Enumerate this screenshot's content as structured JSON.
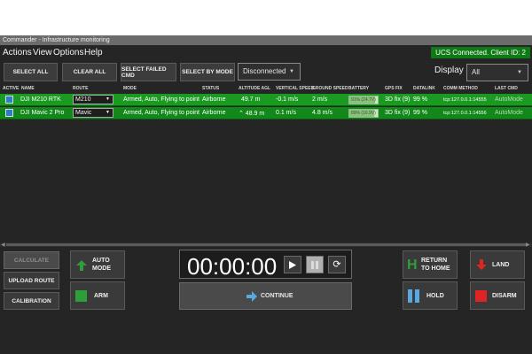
{
  "window": {
    "title": "Commander - Infrastructure monitoring"
  },
  "menu": {
    "items": [
      "Actions",
      "View",
      "Options",
      "Help"
    ]
  },
  "connection": {
    "status_text": "UCS Connected. Client ID: 2",
    "color": "#0d7a15"
  },
  "toolbar": {
    "select_all": "SELECT ALL",
    "clear_all": "CLEAR ALL",
    "select_failed_cmd": "SELECT FAILED CMD",
    "select_by_mode": "SELECT BY MODE",
    "connection_select_value": "Disconnected",
    "display_label": "Display",
    "display_select_value": "All"
  },
  "table": {
    "headers": [
      "ACTIVE",
      "NAME",
      "ROUTE",
      "MODE",
      "STATUS",
      "ALTITUDE AGL",
      "VERTICAL SPEED",
      "GROUND SPEED",
      "BATTERY",
      "GPS FIX",
      "DATALINK",
      "COMM METHOD",
      "LAST CMD"
    ],
    "rows": [
      {
        "active": true,
        "name": "DJI M210 RTK",
        "route": "M210",
        "mode": "Armed, Auto, Flying to point",
        "status": "Airborne",
        "altitude": "49.7 m",
        "vertical_speed": "-0.1 m/s",
        "ground_speed": "2 m/s",
        "battery_text": "91% (24.7V)",
        "battery_level": 0.91,
        "gps_fix": "3D fix (9)",
        "datalink": "99 %",
        "comm_method": "tcp:127.0.0.1:14555",
        "last_cmd": "AutoMode"
      },
      {
        "active": true,
        "name": "DJI Mavic 2 Pro",
        "route": "Mavic",
        "mode": "Armed, Auto, Flying to point",
        "status": "Airborne",
        "altitude": "⌃ 48.9 m",
        "vertical_speed": "0.1 m/s",
        "ground_speed": "4.8 m/s",
        "battery_text": "89% (16.9V)",
        "battery_level": 0.89,
        "gps_fix": "3D fix (9)",
        "datalink": "99 %",
        "comm_method": "tcp:127.0.0.1:14556",
        "last_cmd": "AutoMode"
      }
    ],
    "row_color": "#13881a"
  },
  "controls": {
    "calculate": "CALCULATE",
    "upload_route": "UPLOAD ROUTE",
    "calibration": "CALIBRATION",
    "auto_mode_line1": "AUTO",
    "auto_mode_line2": "MODE",
    "arm": "ARM",
    "timer": "00:00:00",
    "continue": "CONTINUE",
    "return_home_line1": "RETURN",
    "return_home_line2": "TO HOME",
    "hold": "HOLD",
    "land": "LAND",
    "disarm": "DISARM",
    "colors": {
      "green": "#2e9e3a",
      "red": "#e02424",
      "blue": "#5aa8e0"
    }
  },
  "icons": [
    "arrow-up-icon",
    "square-icon",
    "play-icon",
    "pause-icon",
    "refresh-icon",
    "arrow-right-icon",
    "home-h-icon",
    "pause-bars-icon",
    "arrow-down-icon",
    "stop-square-icon",
    "chevron-down-icon"
  ]
}
